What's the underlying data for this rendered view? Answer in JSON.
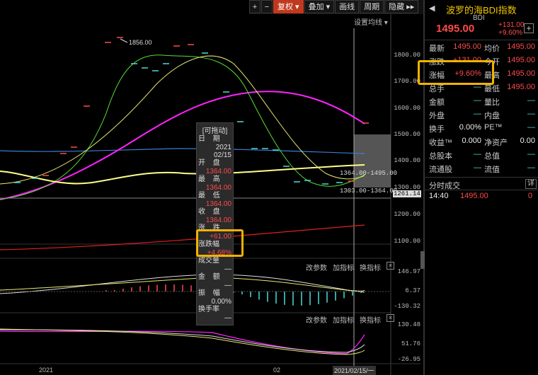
{
  "toolbar": {
    "plus": "+",
    "minus": "−",
    "adjust": "复权 ▾",
    "overlay": "叠加 ▾",
    "draw_line": "画线",
    "period": "周期",
    "hide_indicators": "隐藏 ▸▸"
  },
  "chart": {
    "setting_ma": "设置均线 ▾",
    "peak_label": "1856.00",
    "range_label_1": "1364.00-1495.00",
    "range_label_2": "1303.00-1364.00",
    "current_line_value": "1261.14",
    "y_axis": [
      "1800.00",
      "1700.00",
      "1600.00",
      "1500.00",
      "1400.00",
      "1300.00",
      "1200.00",
      "1100.00"
    ],
    "x_labels": {
      "left": "2021",
      "mid": "02",
      "cursor": "2021/02/15/一"
    },
    "sub1": {
      "params": "改参数",
      "add": "加指标",
      "switch": "换指标",
      "close": "×",
      "y_axis": [
        "146.97",
        "6.37",
        "-130.32"
      ]
    },
    "sub2": {
      "params": "改参数",
      "add": "加指标",
      "switch": "换指标",
      "close": "×",
      "y_axis": [
        "130.48",
        "51.76",
        "-26.95"
      ]
    }
  },
  "tooltip": {
    "title": "[可拖动]",
    "date_label": "日 期",
    "year": "2021",
    "date": "02/15",
    "open_label": "开 盘",
    "open": "1364.00",
    "high_label": "最 高",
    "high": "1364.00",
    "low_label": "最 低",
    "low": "1364.00",
    "close_label": "收 盘",
    "close": "1364.00",
    "change_label": "涨 跌",
    "change": "+61.00",
    "pct_label": "涨跌幅",
    "pct": "+4.68%",
    "volume_label": "成交量",
    "volume": "—",
    "amount_label": "金 额",
    "amount": "—",
    "amplitude_label": "振 幅",
    "amplitude": "0.00%",
    "turnover_label": "换手率",
    "turnover": "—"
  },
  "panel": {
    "title": "波罗的海BDI指数",
    "code": "BDI",
    "price": "1495.00",
    "change": "+131.00",
    "change_pct": "+9.60%",
    "plus": "+",
    "rows": [
      {
        "l1": "最新",
        "v1": "1495.00",
        "l2": "均价",
        "v2": "1495.00"
      },
      {
        "l1": "涨跌",
        "v1": "+131.00",
        "l2": "今开",
        "v2": "1495.00"
      },
      {
        "l1": "涨幅",
        "v1": "+9.60%",
        "l2": "最高",
        "v2": "1495.00"
      },
      {
        "l1": "总手",
        "v1": "—",
        "l2": "最低",
        "v2": "1495.00"
      },
      {
        "l1": "金额",
        "v1": "—",
        "l2": "量比",
        "v2": "—"
      },
      {
        "l1": "外盘",
        "v1": "—",
        "l2": "内盘",
        "v2": "—"
      },
      {
        "l1": "换手",
        "v1": "0.00%",
        "l2": "PE™",
        "v2": "—"
      },
      {
        "l1": "收益™",
        "v1": "0.000",
        "l2": "净资产",
        "v2": "0.00"
      },
      {
        "l1": "总股本",
        "v1": "—",
        "l2": "总值",
        "v2": "—"
      },
      {
        "l1": "流通股",
        "v1": "—",
        "l2": "流值",
        "v2": "—"
      }
    ],
    "tick_title": "分时成交",
    "detail": "详",
    "tick": {
      "time": "14:40",
      "price": "1495.00",
      "vol": "0"
    }
  },
  "colors": {
    "up": "#ff4a4a",
    "down": "#4adada",
    "highlight": "#f2b200",
    "ma_yellow": "#ffff66",
    "ma_magenta": "#ff22ff",
    "ma_green": "#55dd33",
    "ma_blue": "#3a7fd0"
  }
}
